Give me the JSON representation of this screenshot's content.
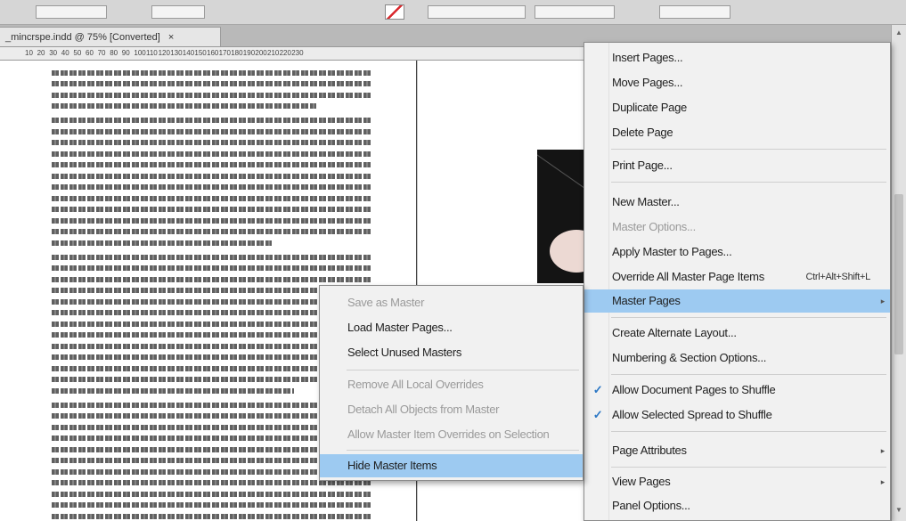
{
  "document": {
    "tab_title": "_mincrspe.indd @ 75% [Converted]",
    "close_glyph": "×"
  },
  "ruler": {
    "ticks": [
      "10",
      "20",
      "30",
      "40",
      "50",
      "60",
      "70",
      "80",
      "90",
      "100",
      "110",
      "120",
      "130",
      "140",
      "150",
      "160",
      "170",
      "180",
      "190",
      "200",
      "210",
      "220",
      "230"
    ]
  },
  "main_menu": {
    "insert_pages": "Insert Pages...",
    "move_pages": "Move Pages...",
    "duplicate_page": "Duplicate Page",
    "delete_page": "Delete Page",
    "print_page": "Print Page...",
    "new_master": "New Master...",
    "master_options": "Master Options...",
    "apply_master": "Apply Master to Pages...",
    "override_all": "Override All Master Page Items",
    "override_all_shortcut": "Ctrl+Alt+Shift+L",
    "master_pages": "Master Pages",
    "create_alternate": "Create Alternate Layout...",
    "numbering": "Numbering & Section Options...",
    "allow_doc_shuffle": "Allow Document Pages to Shuffle",
    "allow_spread_shuffle": "Allow Selected Spread to Shuffle",
    "page_attributes": "Page Attributes",
    "view_pages": "View Pages",
    "panel_options": "Panel Options..."
  },
  "sub_menu": {
    "save_as_master": "Save as Master",
    "load_master_pages": "Load Master Pages...",
    "select_unused": "Select Unused Masters",
    "remove_local_overrides": "Remove All Local Overrides",
    "detach_all": "Detach All Objects from Master",
    "allow_overrides": "Allow Master Item Overrides on Selection",
    "hide_master_items": "Hide Master Items"
  },
  "icons": {
    "checkmark": "✓",
    "submenu_arrow": "▸",
    "scroll_up": "▲",
    "scroll_down": "▼"
  },
  "colors": {
    "menu_highlight": "#9dcaf1",
    "check_color": "#2b77c5"
  }
}
